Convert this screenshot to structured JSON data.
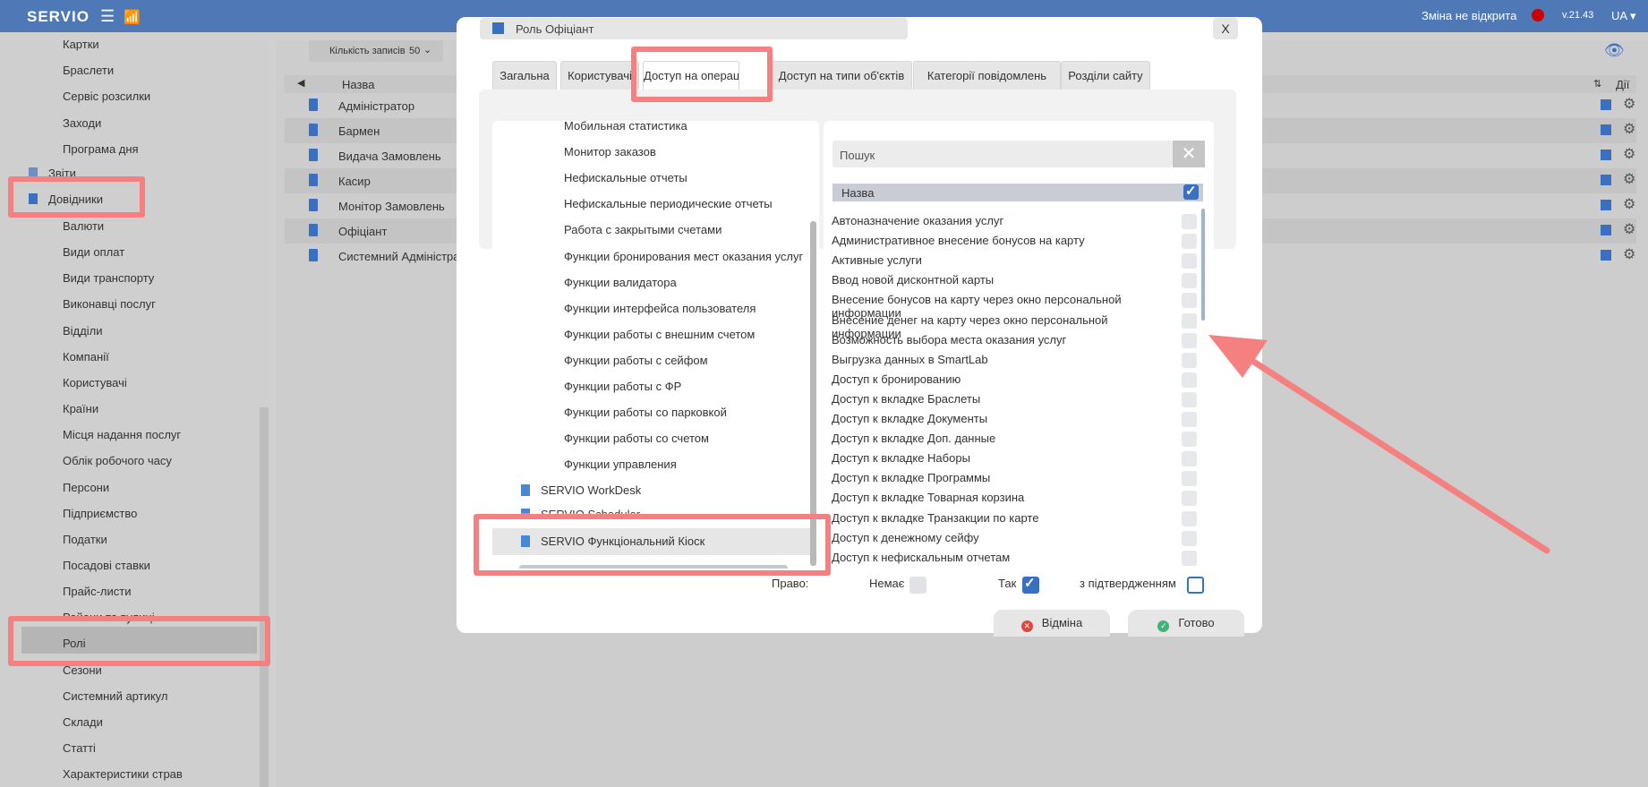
{
  "topbar": {
    "logo": "SERVIO",
    "shift_status": "Зміна не відкрита",
    "version": "v.21.43",
    "language": "UA"
  },
  "sidebar": {
    "items": [
      "Картки",
      "Браслети",
      "Сервіс розсилки",
      "Заходи",
      "Програма дня"
    ],
    "reports": "Звіти",
    "references": "Довідники",
    "ref_items": [
      "Валюти",
      "Види оплат",
      "Види транспорту",
      "Виконавці послуг",
      "Відділи",
      "Компанії",
      "Користувачі",
      "Країни",
      "Місця надання послуг",
      "Облік робочого часу",
      "Персони",
      "Підприємство",
      "Податки",
      "Посадові ставки",
      "Прайс-листи",
      "Райони та вулиці",
      "Ролі",
      "Сезони",
      "Системний артикул",
      "Склади",
      "Статті",
      "Характеристики страв"
    ]
  },
  "main": {
    "records_label": "Кількість записів",
    "records_value": "50",
    "col_name": "Назва",
    "col_actions": "Дії",
    "rows": [
      "Адміністратор",
      "Бармен",
      "Видача Замовлень",
      "Касир",
      "Монітор Замовлень",
      "Офіціант",
      "Системний Адміністратор"
    ]
  },
  "modal": {
    "title": "Роль Офіціант",
    "close": "X",
    "tabs": [
      "Загальна",
      "Користувачі",
      "Доступ на операції",
      "Доступ на типи об'єктів",
      "Категорії повідомлень",
      "Розділи сайту"
    ],
    "tree": {
      "items": [
        "Мобильная статистика",
        "Монитор заказов",
        "Нефискальные отчеты",
        "Нефискальные периодические отчеты",
        "Работа с закрытыми счетами",
        "Функции бронирования мест оказания услуг",
        "Функции валидатора",
        "Функции интерфейса пользователя",
        "Функции работы с внешним счетом",
        "Функции работы с сейфом",
        "Функции работы с ФР",
        "Функции работы со парковкой",
        "Функции работы со счетом",
        "Функции управления"
      ],
      "roots": [
        "SERVIO WorkDesk",
        "SERVIO Scheduler",
        "SERVIO Функціональний Кіоск"
      ]
    },
    "list": {
      "search_placeholder": "Пошук",
      "header": "Назва",
      "operations": [
        "Автоназначение оказания услуг",
        "Административное внесение бонусов на карту",
        "Активные услуги",
        "Ввод новой дисконтной карты",
        "Внесение бонусов на карту через окно персональной информации",
        "Внесение денег на карту через окно персональной информации",
        "Возможность выбора места оказания услуг",
        "Выгрузка данных в SmartLab",
        "Доступ к бронированию",
        "Доступ к вкладке Браслеты",
        "Доступ к вкладке Документы",
        "Доступ к вкладке Доп. данные",
        "Доступ к вкладке Наборы",
        "Доступ к вкладке Программы",
        "Доступ к вкладке Товарная корзина",
        "Доступ к вкладке Транзакции по карте",
        "Доступ к денежному сейфу",
        "Доступ к нефискальным отчетам"
      ]
    },
    "rights": {
      "label": "Право:",
      "none": "Немає",
      "yes": "Так",
      "confirm": "з підтвердженням"
    },
    "cancel": "Відміна",
    "done": "Готово"
  },
  "colors": {
    "topbar": "#4f79b6",
    "accent": "#3b6fbf",
    "highlight": "#f4807f"
  }
}
